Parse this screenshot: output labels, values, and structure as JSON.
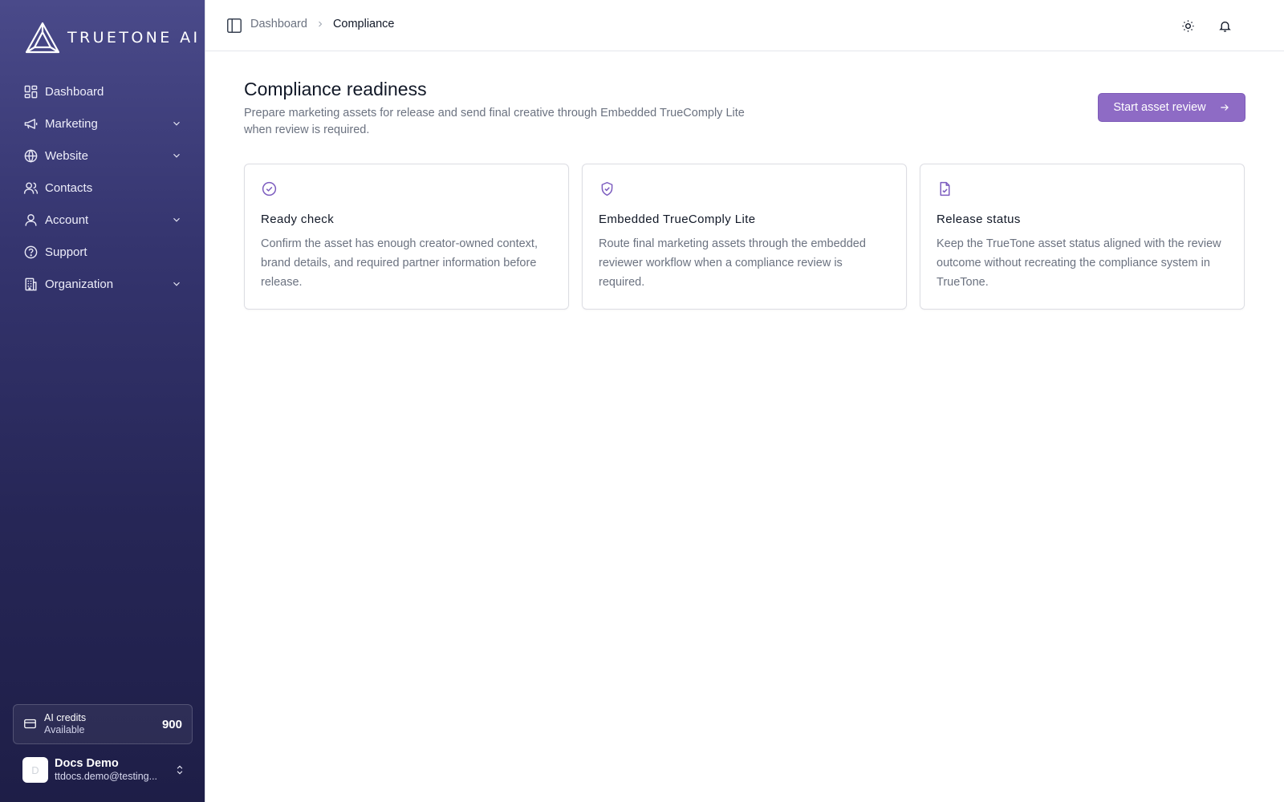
{
  "brand": {
    "name": "TRUETONE AI"
  },
  "sidebar": {
    "items": [
      {
        "label": "Dashboard",
        "icon": "dashboard-icon",
        "expandable": false
      },
      {
        "label": "Marketing",
        "icon": "megaphone-icon",
        "expandable": true
      },
      {
        "label": "Website",
        "icon": "globe-icon",
        "expandable": true
      },
      {
        "label": "Contacts",
        "icon": "users-icon",
        "expandable": false
      },
      {
        "label": "Account",
        "icon": "user-icon",
        "expandable": true
      },
      {
        "label": "Support",
        "icon": "help-circle-icon",
        "expandable": false
      },
      {
        "label": "Organization",
        "icon": "building-icon",
        "expandable": true
      }
    ],
    "credits": {
      "title": "AI credits",
      "subtitle": "Available",
      "value": "900"
    },
    "user": {
      "initial": "D",
      "name": "Docs Demo",
      "email": "ttdocs.demo@testing..."
    }
  },
  "header": {
    "breadcrumb": {
      "parent": "Dashboard",
      "current": "Compliance"
    }
  },
  "main": {
    "title": "Compliance readiness",
    "description": "Prepare marketing assets for release and send final creative through Embedded TrueComply Lite when review is required.",
    "start_button": "Start asset review",
    "cards": [
      {
        "icon": "check-circle-icon",
        "title": "Ready check",
        "body": "Confirm the asset has enough creator-owned context, brand details, and required partner information before release."
      },
      {
        "icon": "shield-check-icon",
        "title": "Embedded TrueComply Lite",
        "body": "Route final marketing assets through the embedded reviewer workflow when a compliance review is required."
      },
      {
        "icon": "file-check-icon",
        "title": "Release status",
        "body": "Keep the TrueTone asset status aligned with the review outcome without recreating the compliance system in TrueTone."
      }
    ]
  },
  "colors": {
    "accent": "#8e6bc5",
    "sidebar_top": "#4a4a8a",
    "sidebar_bottom": "#1e1e47"
  }
}
